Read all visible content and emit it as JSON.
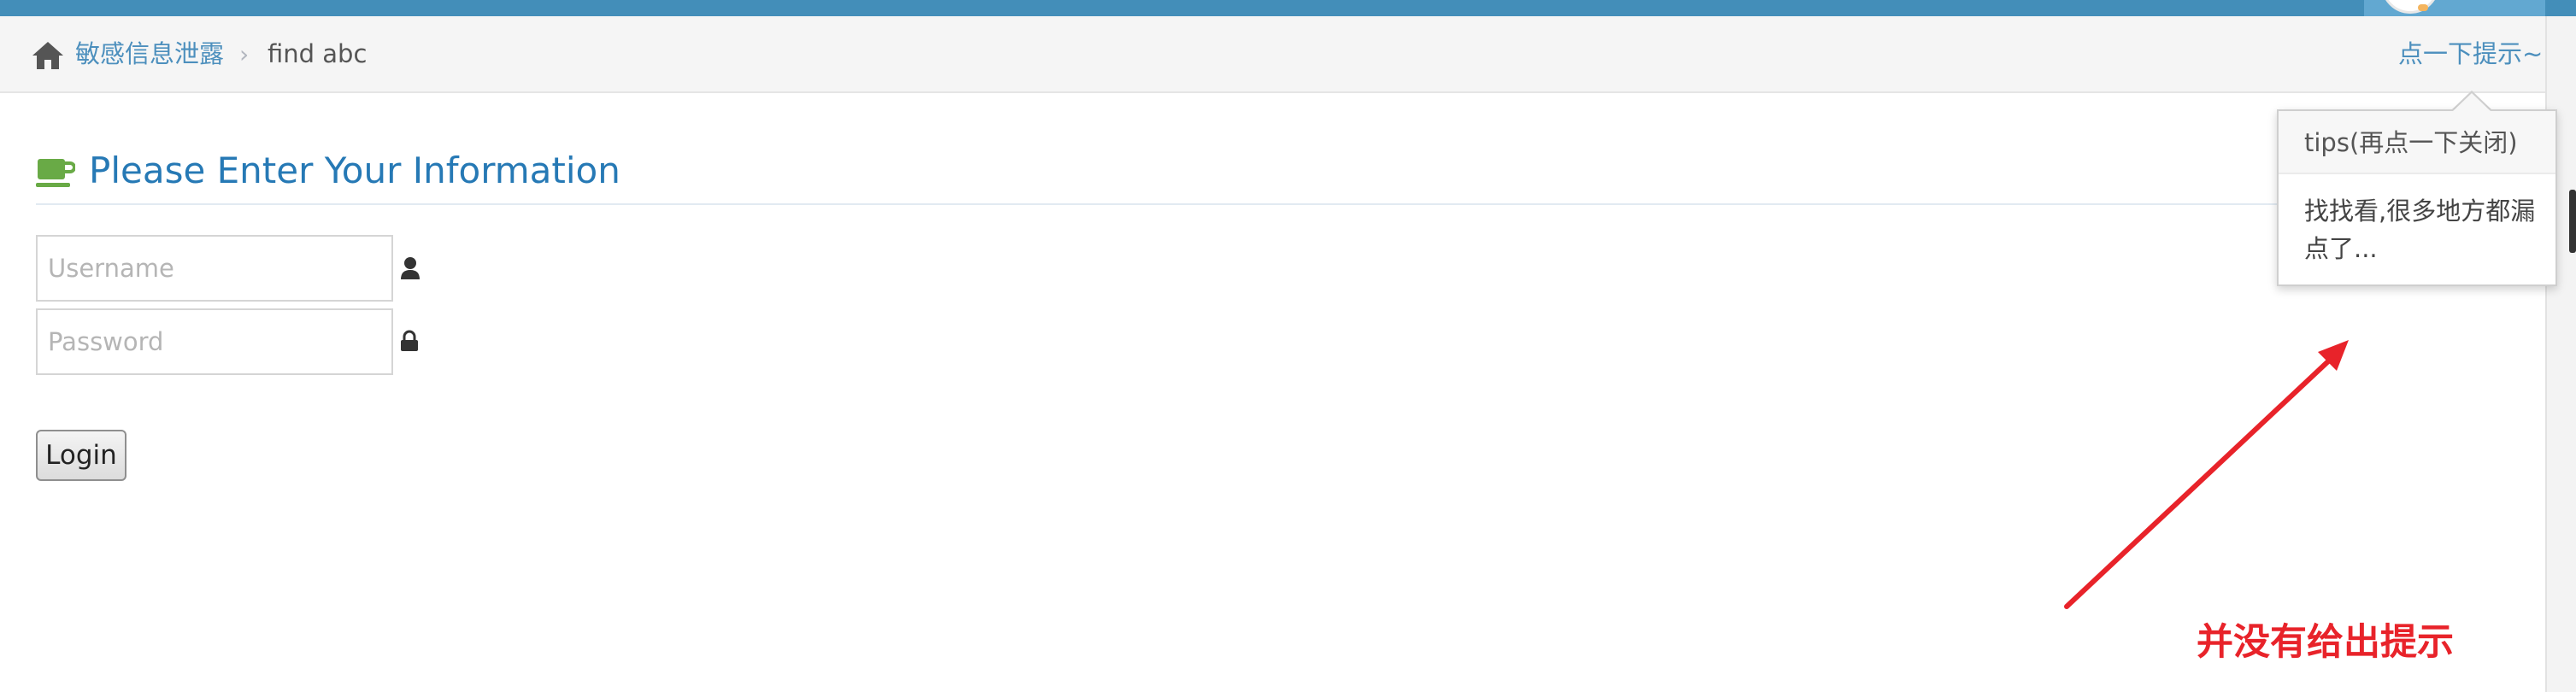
{
  "breadcrumb": {
    "home_icon": "home-icon",
    "parent": "敏感信息泄露",
    "separator": "›",
    "current": "find abc"
  },
  "hint": {
    "label": "点一下提示~"
  },
  "header": {
    "icon": "coffee-cup-icon",
    "title": "Please Enter Your Information"
  },
  "form": {
    "username_placeholder": "Username",
    "username_icon": "user-icon",
    "password_placeholder": "Password",
    "password_icon": "lock-icon",
    "login_label": "Login"
  },
  "popover": {
    "title": "tips(再点一下关闭)",
    "body": "找找看,很多地方都漏点了..."
  },
  "annotation": {
    "text": "并没有给出提示",
    "color": "#e8232a"
  },
  "colors": {
    "topbar": "#438eb9",
    "link": "#4c8fbd",
    "title": "#2679b5",
    "cup_icon": "#69aa46"
  }
}
